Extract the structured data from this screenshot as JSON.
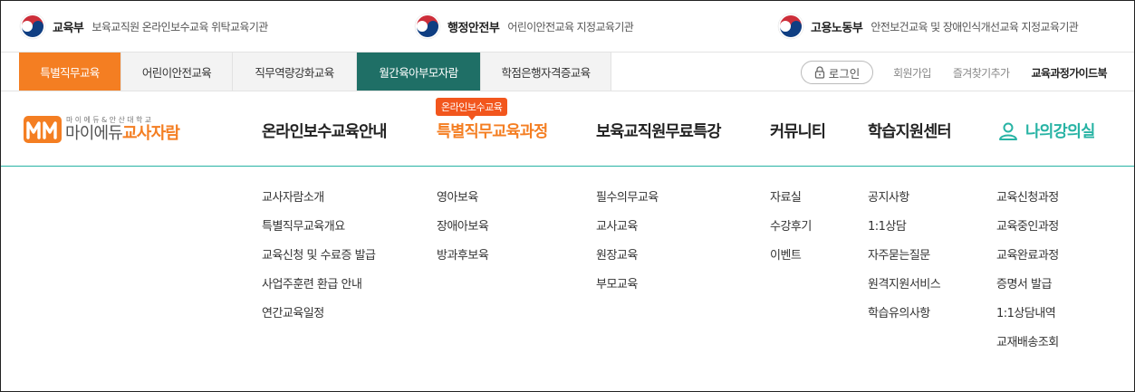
{
  "agencies": [
    {
      "name": "교육부",
      "desc": "보육교직원 온라인보수교육 위탁교육기관"
    },
    {
      "name": "행정안전부",
      "desc": "어린이안전교육 지정교육기관"
    },
    {
      "name": "고용노동부",
      "desc": "안전보건교육 및 장애인식개선교육 지정교육기관"
    }
  ],
  "tabs": [
    "특별직무교육",
    "어린이안전교육",
    "직무역량강화교육",
    "월간육아부모자람",
    "학점은행자격증교육"
  ],
  "util": {
    "login": "로그인",
    "join": "회원가입",
    "favorite": "즐겨찾기추가",
    "guide": "교육과정가이드북"
  },
  "logo": {
    "sub": "마이에듀&안산대학교",
    "main_prefix": "마이에듀",
    "main_accent": "교사자람"
  },
  "badge": "온라인보수교육",
  "menu": [
    "온라인보수교육안내",
    "특별직무교육과정",
    "보육교직원무료특강",
    "커뮤니티",
    "학습지원센터",
    "나의강의실"
  ],
  "submenus": [
    [
      "교사자람소개",
      "특별직무교육개요",
      "교육신청 및 수료증 발급",
      "사업주훈련 환급 안내",
      "연간교육일정"
    ],
    [
      "영아보육",
      "장애아보육",
      "방과후보육"
    ],
    [
      "필수의무교육",
      "교사교육",
      "원장교육",
      "부모교육"
    ],
    [
      "자료실",
      "수강후기",
      "이벤트"
    ],
    [
      "공지사항",
      "1:1상담",
      "자주묻는질문",
      "원격지원서비스",
      "학습유의사항"
    ],
    [
      "교육신청과정",
      "교육중인과정",
      "교육완료과정",
      "증명서 발급",
      "1:1상담내역",
      "교재배송조회"
    ]
  ],
  "colors": {
    "orange": "#f47e22",
    "teal_tab": "#1f6f66",
    "teal": "#27b3a4",
    "badge": "#f2561d"
  }
}
